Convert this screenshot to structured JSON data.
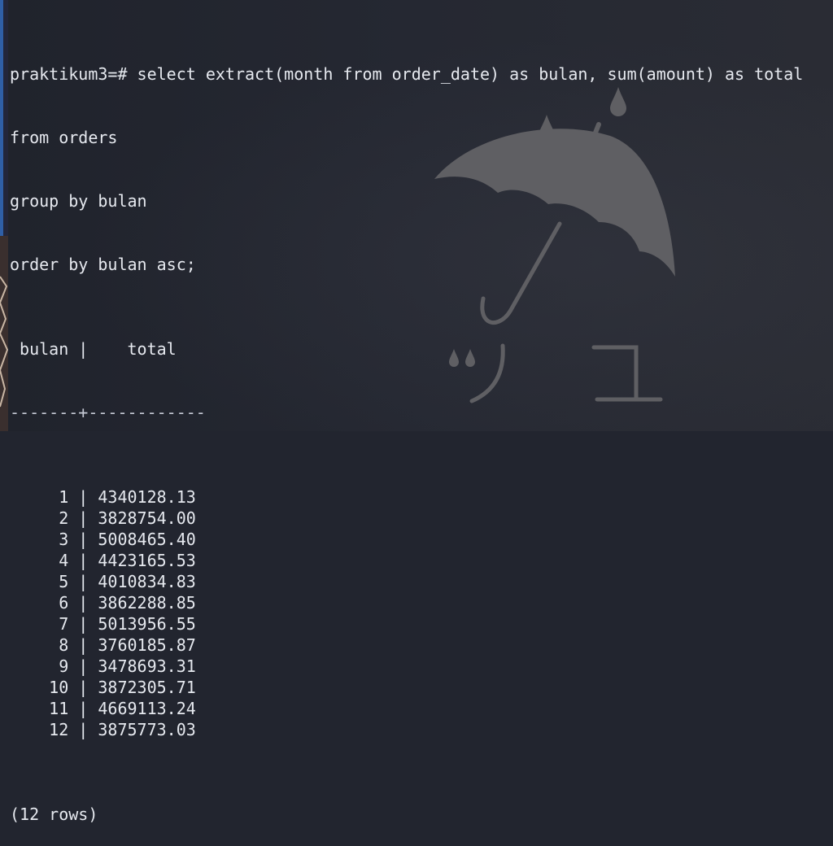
{
  "terminal": {
    "prompt": "praktikum3=#",
    "query_lines": [
      "select extract(month from order_date) as bulan, sum(amount) as total",
      "from orders",
      "group by bulan",
      "order by bulan asc;"
    ],
    "header": {
      "col1": "bulan",
      "col2": "total"
    },
    "separator": "-------+------------",
    "rows": [
      {
        "bulan": "1",
        "total": "4340128.13"
      },
      {
        "bulan": "2",
        "total": "3828754.00"
      },
      {
        "bulan": "3",
        "total": "5008465.40"
      },
      {
        "bulan": "4",
        "total": "4423165.53"
      },
      {
        "bulan": "5",
        "total": "4010834.83"
      },
      {
        "bulan": "6",
        "total": "3862288.85"
      },
      {
        "bulan": "7",
        "total": "5013956.55"
      },
      {
        "bulan": "8",
        "total": "3760185.87"
      },
      {
        "bulan": "9",
        "total": "3478693.31"
      },
      {
        "bulan": "10",
        "total": "3872305.71"
      },
      {
        "bulan": "11",
        "total": "4669113.24"
      },
      {
        "bulan": "12",
        "total": "3875773.03"
      }
    ],
    "footer": "(12 rows)"
  },
  "wallpaper": {
    "icon": "umbrella-rain-icon",
    "glyph_left": "ツ",
    "glyph_right": "ユ",
    "color": "#5f5f63"
  },
  "colors": {
    "background": "#22252f",
    "text": "#e6e9ef"
  }
}
